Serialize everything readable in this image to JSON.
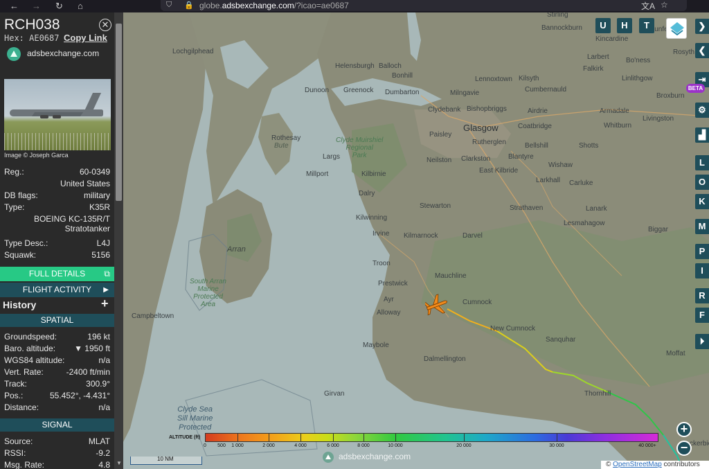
{
  "browser": {
    "url_prefix": "globe.",
    "url_domain": "adsbexchange.com",
    "url_path": "/?icao=ae0687"
  },
  "sidebar": {
    "callsign": "RCH038",
    "hex_label": "Hex: AE0687",
    "copy_link": "Copy Link",
    "brand": "adsbexchange.com",
    "photo_credit": "Image © Joseph Garca",
    "fields": [
      {
        "key": "Reg.:",
        "value": "60-0349"
      },
      {
        "key": "",
        "value": "United States"
      },
      {
        "key": "DB flags:",
        "value": "military"
      },
      {
        "key": "Type:",
        "value": "K35R"
      },
      {
        "key": "",
        "value": "BOEING KC-135R/T"
      },
      {
        "key": "",
        "value": "Stratotanker"
      },
      {
        "key": "Type Desc.:",
        "value": "L4J"
      },
      {
        "key": "Squawk:",
        "value": "5156"
      }
    ],
    "full_details": "FULL DETAILS",
    "flight_activity": "FLIGHT ACTIVITY",
    "history": "History",
    "spatial_title": "SPATIAL",
    "spatial": [
      {
        "key": "Groundspeed:",
        "value": "196 kt"
      },
      {
        "key": "Baro. altitude:",
        "value": "▼ 1950 ft"
      },
      {
        "key": "WGS84 altitude:",
        "value": "n/a"
      },
      {
        "key": "Vert. Rate:",
        "value": "-2400 ft/min"
      },
      {
        "key": "Track:",
        "value": "300.9°"
      },
      {
        "key": "Pos.:",
        "value": "55.452°, -4.431°"
      },
      {
        "key": "Distance:",
        "value": "n/a"
      }
    ],
    "signal_title": "SIGNAL",
    "signal": [
      {
        "key": "Source:",
        "value": "MLAT"
      },
      {
        "key": "RSSI:",
        "value": "-9.2"
      },
      {
        "key": "Msg. Rate:",
        "value": "4.8"
      }
    ]
  },
  "map": {
    "places": {
      "stirling": "Stirling",
      "bannockburn": "Bannockburn",
      "kincardine": "Kincardine",
      "dunfermline": "Dunferm",
      "rosyth": "Rosyth",
      "larbert": "Larbert",
      "falkirk": "Falkirk",
      "boness": "Bo'ness",
      "linlithgow": "Linlithgow",
      "lochgilphead": "Lochgilphead",
      "helensburgh": "Helensburgh",
      "balloch": "Balloch",
      "bonhill": "Bonhill",
      "lennoxtown": "Lennoxtown",
      "kilsyth": "Kilsyth",
      "cumbernauld": "Cumbernauld",
      "broxburn": "Broxburn",
      "dunoon": "Dunoon",
      "greenock": "Greenock",
      "dumbarton": "Dumbarton",
      "milngavie": "Milngavie",
      "clydebank": "Clydebank",
      "bishopbriggs": "Bishopbriggs",
      "airdrie": "Airdrie",
      "armadale": "Armadale",
      "livingston": "Livingston",
      "glasgow": "Glasgow",
      "coatbridge": "Coatbridge",
      "whitburn": "Whitburn",
      "rothesay": "Rothesay",
      "bute": "Bute",
      "paisley": "Paisley",
      "rutherglen": "Rutherglen",
      "bellshill": "Bellshill",
      "shotts": "Shotts",
      "largs": "Largs",
      "neilston": "Neilston",
      "clarkston": "Clarkston",
      "blantyre": "Blantyre",
      "wishaw": "Wishaw",
      "millport": "Millport",
      "kilbirnie": "Kilbirnie",
      "east_kilbride": "East Kilbride",
      "larkhall": "Larkhall",
      "carluke": "Carluke",
      "dalry": "Dalry",
      "stewarton": "Stewarton",
      "strathaven": "Strathaven",
      "lanark": "Lanark",
      "kilwinning": "Kilwinning",
      "lesmahagow": "Lesmahagow",
      "arran": "Arran",
      "irvine": "Irvine",
      "kilmarnock": "Kilmarnock",
      "darvel": "Darvel",
      "biggar": "Biggar",
      "troon": "Troon",
      "mauchline": "Mauchline",
      "prestwick": "Prestwick",
      "ayr": "Ayr",
      "cumnock": "Cumnock",
      "campbeltown": "Campbeltown",
      "alloway": "Alloway",
      "new_cumnock": "New Cumnock",
      "sanquhar": "Sanquhar",
      "maybole": "Maybole",
      "moffat": "Moffat",
      "dalmellington": "Dalmellington",
      "thornhill": "Thornhill",
      "girvan": "Girvan",
      "lockerbie": "ckerbie",
      "clyde_park": "Clyde Muirshiel\nRegional\nPark",
      "arran_park": "South Arran\nMarine\nProtected\nArea",
      "clyde_sea": "Clyde Sea\nSill Marine\nProtected"
    },
    "buttons": {
      "u": "U",
      "h": "H",
      "t": "T"
    },
    "right_buttons": [
      "L",
      "O",
      "K",
      "M",
      "P",
      "I",
      "R",
      "F"
    ],
    "beta": "BETA",
    "zoom_in": "+",
    "zoom_out": "−",
    "scale": "10 NM",
    "watermark": "adsbexchange.com",
    "attribution_prefix": "© ",
    "attribution_link": "OpenStreetMap",
    "attribution_suffix": " contributors",
    "legend_label": "ALTITUDE (ft)",
    "legend_ticks": [
      "0",
      "500",
      "1 000",
      "2 000",
      "4 000",
      "6 000",
      "8 000",
      "10 000",
      "20 000",
      "30 000",
      "40 000+"
    ],
    "aircraft_track_deg": 300.9,
    "colors": {
      "sea": "#a8b8b8",
      "land": "#8c8d7b",
      "aircraft": "#f08a1c",
      "accent_green": "#27c985",
      "accent_teal": "#1f4e5a"
    }
  }
}
